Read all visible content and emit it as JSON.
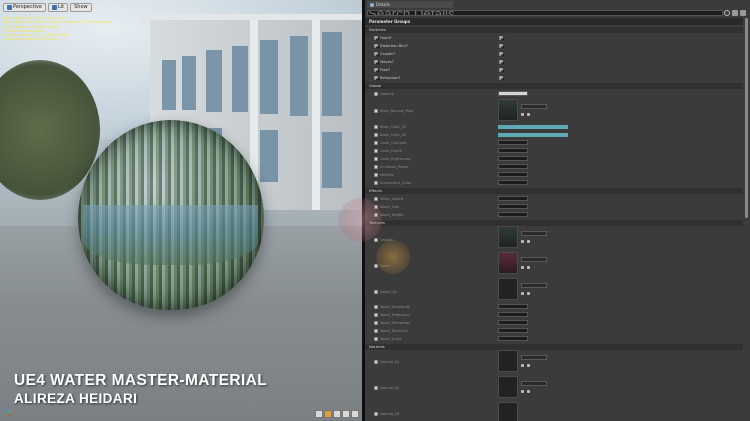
{
  "viewport": {
    "toolbar": {
      "perspective_label": "Perspective",
      "lit_label": "Lit",
      "show_label": "Show"
    },
    "stats": [
      "Base pass shader: 700 instructions",
      "Base pass shader with volumetric lightmap: 750 instructions",
      "Vertex shader: 109 instructions",
      "Texture samplers: 8/16",
      "Texture Lookups (Est.): VS(0), PS(26)",
      "User interpolators: 4/4 Scalars"
    ],
    "title": "UE4 WATER MASTER-MATERIAL",
    "author": "ALIREZA HEIDARI"
  },
  "panel": {
    "tab_label": "Details",
    "search_placeholder": "Search Details",
    "group_header": "Parameter Groups",
    "categories": {
      "switches": "Switches",
      "global": "Global",
      "effects": "Effects",
      "textures": "Textures",
      "normals": "Normals"
    },
    "switches": [
      {
        "label": "Foam?",
        "value": true
      },
      {
        "label": "Distortion Blur?",
        "value": true
      },
      {
        "label": "Caustic?",
        "value": true
      },
      {
        "label": "Waves?",
        "value": true
      },
      {
        "label": "Flow?",
        "value": true
      },
      {
        "label": "Refraction?",
        "value": true
      }
    ],
    "global_first": "Opacity",
    "global_params": [
      "Base_Color_01",
      "Base_Color_02",
      "Color_Contrast",
      "Color_Depth",
      "Color_Brightness",
      "Emissive_Power",
      "Metallic",
      "Subsurface_Color"
    ],
    "global_texture_label": "Base_Normal_Map",
    "effects_params": [
      "Wave_Speed",
      "Wave_Size",
      "Wave_Height"
    ],
    "texture_params": [
      "Caustic",
      "Foam",
      "Detail_01"
    ],
    "texture_slots": [
      "Water_Caustic_01",
      "Water_Foam_01",
      "Water_Detail_01"
    ],
    "numeric_params": [
      "Wave_Amplitude",
      "Wave_Frequency",
      "Wave_Steepness",
      "Wave_Direction",
      "Wave_Scale"
    ],
    "normal_params": [
      "Normal_01",
      "Normal_02",
      "Normal_03"
    ],
    "normal_slots": [
      "T_Water_N_01",
      "T_Water_N_02"
    ]
  }
}
